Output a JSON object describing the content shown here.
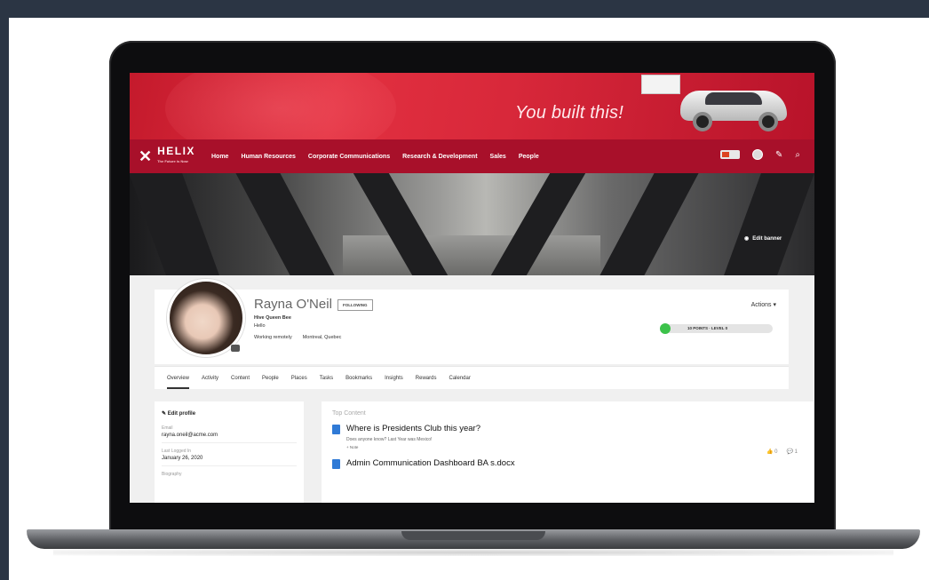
{
  "banner": {
    "slogan": "You built this!"
  },
  "nav": {
    "logo": "HELIX",
    "tagline": "The Future is Now",
    "items": [
      "Home",
      "Human Resources",
      "Corporate Communications",
      "Research & Development",
      "Sales",
      "People"
    ],
    "flag_count": "1"
  },
  "cover": {
    "edit_label": "Edit banner"
  },
  "profile": {
    "name": "Rayna O'Neil",
    "follow_label": "FOLLOWING",
    "title": "Hive Queen Bee",
    "greeting": "Hello",
    "status": "Working remotely",
    "location": "Montreal, Quebec",
    "actions_label": "Actions",
    "points": "10 POINTS · LEVEL 0"
  },
  "tabs": [
    "Overview",
    "Activity",
    "Content",
    "People",
    "Places",
    "Tasks",
    "Bookmarks",
    "Insights",
    "Rewards",
    "Calendar"
  ],
  "sidebar": {
    "edit_label": "Edit profile",
    "email_label": "Email",
    "email": "rayna.oneil@acme.com",
    "last_logged_label": "Last Logged In",
    "last_logged": "January 26, 2020",
    "bio_label": "Biography"
  },
  "content": {
    "header": "Top Content",
    "items": [
      {
        "title": "Where is Presidents Club this year?",
        "snippet": "Does anyone know? Last Year was Mexico!",
        "more": "+ Note",
        "likes": "0",
        "comments": "1"
      },
      {
        "title": "Admin Communication Dashboard BA s.docx"
      }
    ]
  },
  "colors": {
    "brand_red": "#a8102a",
    "banner_red": "#d8283a",
    "points_green": "#3cc24a",
    "doc_blue": "#2f7ad6"
  }
}
